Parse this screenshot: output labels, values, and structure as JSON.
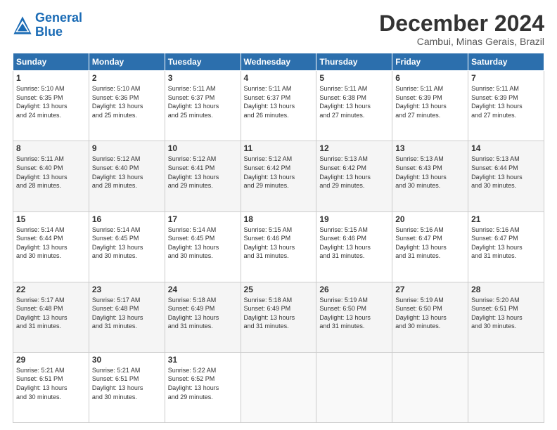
{
  "logo": {
    "line1": "General",
    "line2": "Blue"
  },
  "title": "December 2024",
  "subtitle": "Cambui, Minas Gerais, Brazil",
  "days_header": [
    "Sunday",
    "Monday",
    "Tuesday",
    "Wednesday",
    "Thursday",
    "Friday",
    "Saturday"
  ],
  "weeks": [
    [
      {
        "day": "1",
        "info": "Sunrise: 5:10 AM\nSunset: 6:35 PM\nDaylight: 13 hours\nand 24 minutes."
      },
      {
        "day": "2",
        "info": "Sunrise: 5:10 AM\nSunset: 6:36 PM\nDaylight: 13 hours\nand 25 minutes."
      },
      {
        "day": "3",
        "info": "Sunrise: 5:11 AM\nSunset: 6:37 PM\nDaylight: 13 hours\nand 25 minutes."
      },
      {
        "day": "4",
        "info": "Sunrise: 5:11 AM\nSunset: 6:37 PM\nDaylight: 13 hours\nand 26 minutes."
      },
      {
        "day": "5",
        "info": "Sunrise: 5:11 AM\nSunset: 6:38 PM\nDaylight: 13 hours\nand 27 minutes."
      },
      {
        "day": "6",
        "info": "Sunrise: 5:11 AM\nSunset: 6:39 PM\nDaylight: 13 hours\nand 27 minutes."
      },
      {
        "day": "7",
        "info": "Sunrise: 5:11 AM\nSunset: 6:39 PM\nDaylight: 13 hours\nand 27 minutes."
      }
    ],
    [
      {
        "day": "8",
        "info": "Sunrise: 5:11 AM\nSunset: 6:40 PM\nDaylight: 13 hours\nand 28 minutes."
      },
      {
        "day": "9",
        "info": "Sunrise: 5:12 AM\nSunset: 6:40 PM\nDaylight: 13 hours\nand 28 minutes."
      },
      {
        "day": "10",
        "info": "Sunrise: 5:12 AM\nSunset: 6:41 PM\nDaylight: 13 hours\nand 29 minutes."
      },
      {
        "day": "11",
        "info": "Sunrise: 5:12 AM\nSunset: 6:42 PM\nDaylight: 13 hours\nand 29 minutes."
      },
      {
        "day": "12",
        "info": "Sunrise: 5:13 AM\nSunset: 6:42 PM\nDaylight: 13 hours\nand 29 minutes."
      },
      {
        "day": "13",
        "info": "Sunrise: 5:13 AM\nSunset: 6:43 PM\nDaylight: 13 hours\nand 30 minutes."
      },
      {
        "day": "14",
        "info": "Sunrise: 5:13 AM\nSunset: 6:44 PM\nDaylight: 13 hours\nand 30 minutes."
      }
    ],
    [
      {
        "day": "15",
        "info": "Sunrise: 5:14 AM\nSunset: 6:44 PM\nDaylight: 13 hours\nand 30 minutes."
      },
      {
        "day": "16",
        "info": "Sunrise: 5:14 AM\nSunset: 6:45 PM\nDaylight: 13 hours\nand 30 minutes."
      },
      {
        "day": "17",
        "info": "Sunrise: 5:14 AM\nSunset: 6:45 PM\nDaylight: 13 hours\nand 30 minutes."
      },
      {
        "day": "18",
        "info": "Sunrise: 5:15 AM\nSunset: 6:46 PM\nDaylight: 13 hours\nand 31 minutes."
      },
      {
        "day": "19",
        "info": "Sunrise: 5:15 AM\nSunset: 6:46 PM\nDaylight: 13 hours\nand 31 minutes."
      },
      {
        "day": "20",
        "info": "Sunrise: 5:16 AM\nSunset: 6:47 PM\nDaylight: 13 hours\nand 31 minutes."
      },
      {
        "day": "21",
        "info": "Sunrise: 5:16 AM\nSunset: 6:47 PM\nDaylight: 13 hours\nand 31 minutes."
      }
    ],
    [
      {
        "day": "22",
        "info": "Sunrise: 5:17 AM\nSunset: 6:48 PM\nDaylight: 13 hours\nand 31 minutes."
      },
      {
        "day": "23",
        "info": "Sunrise: 5:17 AM\nSunset: 6:48 PM\nDaylight: 13 hours\nand 31 minutes."
      },
      {
        "day": "24",
        "info": "Sunrise: 5:18 AM\nSunset: 6:49 PM\nDaylight: 13 hours\nand 31 minutes."
      },
      {
        "day": "25",
        "info": "Sunrise: 5:18 AM\nSunset: 6:49 PM\nDaylight: 13 hours\nand 31 minutes."
      },
      {
        "day": "26",
        "info": "Sunrise: 5:19 AM\nSunset: 6:50 PM\nDaylight: 13 hours\nand 31 minutes."
      },
      {
        "day": "27",
        "info": "Sunrise: 5:19 AM\nSunset: 6:50 PM\nDaylight: 13 hours\nand 30 minutes."
      },
      {
        "day": "28",
        "info": "Sunrise: 5:20 AM\nSunset: 6:51 PM\nDaylight: 13 hours\nand 30 minutes."
      }
    ],
    [
      {
        "day": "29",
        "info": "Sunrise: 5:21 AM\nSunset: 6:51 PM\nDaylight: 13 hours\nand 30 minutes."
      },
      {
        "day": "30",
        "info": "Sunrise: 5:21 AM\nSunset: 6:51 PM\nDaylight: 13 hours\nand 30 minutes."
      },
      {
        "day": "31",
        "info": "Sunrise: 5:22 AM\nSunset: 6:52 PM\nDaylight: 13 hours\nand 29 minutes."
      },
      {
        "day": "",
        "info": ""
      },
      {
        "day": "",
        "info": ""
      },
      {
        "day": "",
        "info": ""
      },
      {
        "day": "",
        "info": ""
      }
    ]
  ]
}
